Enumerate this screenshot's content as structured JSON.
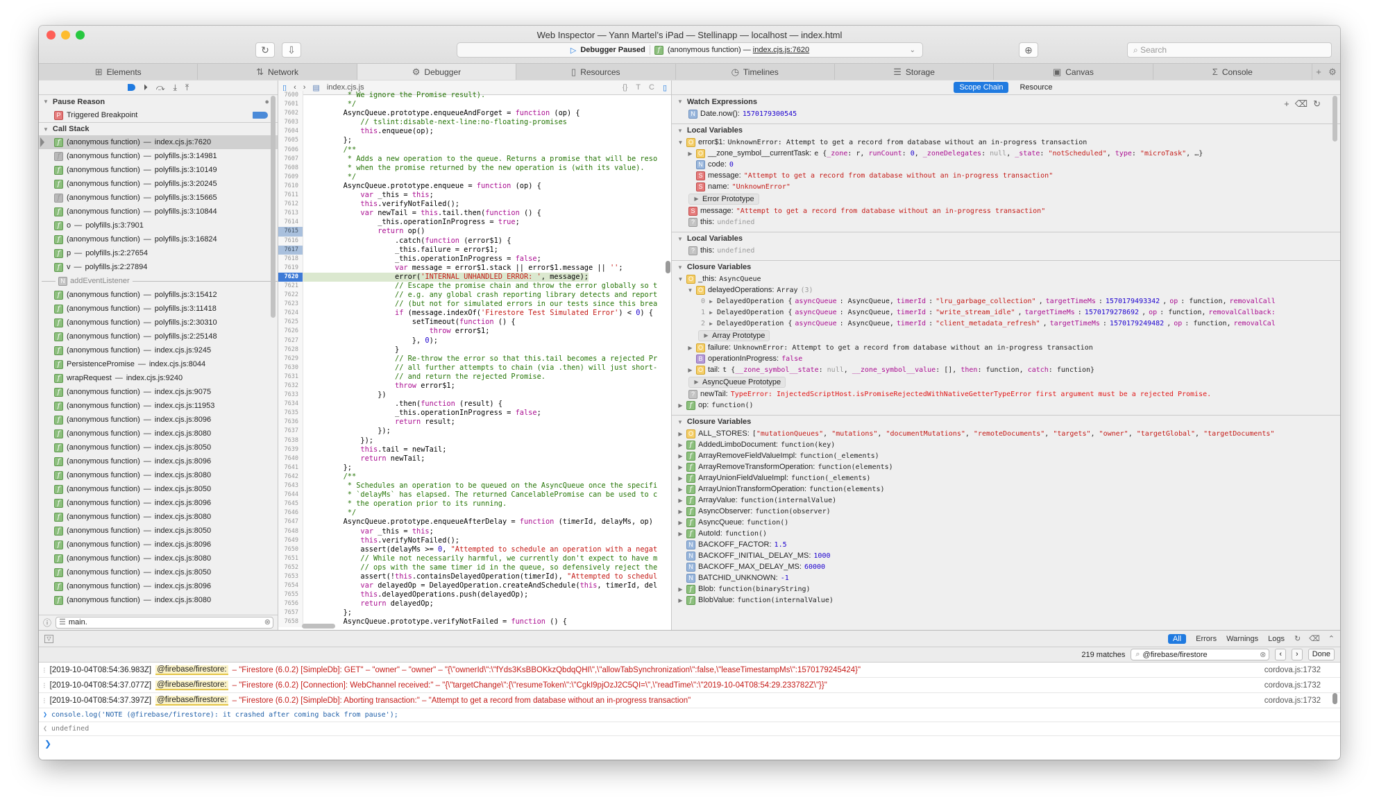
{
  "window": {
    "title": "Web Inspector — Yann Martel’s iPad — Stellinapp — localhost — index.html",
    "dashboard": {
      "status": "Debugger Paused",
      "frame_prefix": "(anonymous function) — ",
      "frame_link": "index.cjs.js:7620"
    },
    "search_placeholder": "Search"
  },
  "tabs": [
    {
      "label": "Elements",
      "icon": "elements-icon",
      "glyph": "⊞"
    },
    {
      "label": "Network",
      "icon": "network-icon",
      "glyph": "⇅"
    },
    {
      "label": "Debugger",
      "icon": "debugger-icon",
      "glyph": "⚙",
      "active": true
    },
    {
      "label": "Resources",
      "icon": "resources-icon",
      "glyph": "▯"
    },
    {
      "label": "Timelines",
      "icon": "timelines-icon",
      "glyph": "◷"
    },
    {
      "label": "Storage",
      "icon": "storage-icon",
      "glyph": "☰"
    },
    {
      "label": "Canvas",
      "icon": "canvas-icon",
      "glyph": "▣"
    },
    {
      "label": "Console",
      "icon": "console-icon",
      "glyph": "Σ"
    }
  ],
  "navigator": {
    "pause_reason_header": "Pause Reason",
    "pause_reason": "Triggered Breakpoint",
    "call_stack_header": "Call Stack",
    "frames_a": [
      {
        "name": "(anonymous function)",
        "loc": "index.cjs.js:7620",
        "kind": "f",
        "selected": true
      },
      {
        "name": "(anonymous function)",
        "loc": "polyfills.js:3:14981",
        "kind": "fgray"
      },
      {
        "name": "(anonymous function)",
        "loc": "polyfills.js:3:10149",
        "kind": "f"
      },
      {
        "name": "(anonymous function)",
        "loc": "polyfills.js:3:20245",
        "kind": "f"
      },
      {
        "name": "(anonymous function)",
        "loc": "polyfills.js:3:15665",
        "kind": "fgray"
      },
      {
        "name": "(anonymous function)",
        "loc": "polyfills.js:3:10844",
        "kind": "f"
      },
      {
        "name": "o",
        "loc": "polyfills.js:3:7901",
        "kind": "f"
      },
      {
        "name": "(anonymous function)",
        "loc": "polyfills.js:3:16824",
        "kind": "f"
      },
      {
        "name": "p",
        "loc": "polyfills.js:2:27654",
        "kind": "f"
      },
      {
        "name": "v",
        "loc": "polyfills.js:2:27894",
        "kind": "f"
      }
    ],
    "async_boundary": "addEventListener",
    "frames_b": [
      {
        "name": "(anonymous function)",
        "loc": "polyfills.js:3:15412"
      },
      {
        "name": "(anonymous function)",
        "loc": "polyfills.js:3:11418"
      },
      {
        "name": "(anonymous function)",
        "loc": "polyfills.js:2:30310"
      },
      {
        "name": "(anonymous function)",
        "loc": "polyfills.js:2:25148"
      },
      {
        "name": "(anonymous function)",
        "loc": "index.cjs.js:9245"
      },
      {
        "name": "PersistencePromise",
        "loc": "index.cjs.js:8044"
      },
      {
        "name": "wrapRequest",
        "loc": "index.cjs.js:9240"
      },
      {
        "name": "(anonymous function)",
        "loc": "index.cjs.js:9075"
      },
      {
        "name": "(anonymous function)",
        "loc": "index.cjs.js:11953"
      },
      {
        "name": "(anonymous function)",
        "loc": "index.cjs.js:8096"
      },
      {
        "name": "(anonymous function)",
        "loc": "index.cjs.js:8080"
      },
      {
        "name": "(anonymous function)",
        "loc": "index.cjs.js:8050"
      },
      {
        "name": "(anonymous function)",
        "loc": "index.cjs.js:8096"
      },
      {
        "name": "(anonymous function)",
        "loc": "index.cjs.js:8080"
      },
      {
        "name": "(anonymous function)",
        "loc": "index.cjs.js:8050"
      },
      {
        "name": "(anonymous function)",
        "loc": "index.cjs.js:8096"
      },
      {
        "name": "(anonymous function)",
        "loc": "index.cjs.js:8080"
      },
      {
        "name": "(anonymous function)",
        "loc": "index.cjs.js:8050"
      },
      {
        "name": "(anonymous function)",
        "loc": "index.cjs.js:8096"
      },
      {
        "name": "(anonymous function)",
        "loc": "index.cjs.js:8080"
      },
      {
        "name": "(anonymous function)",
        "loc": "index.cjs.js:8050"
      },
      {
        "name": "(anonymous function)",
        "loc": "index.cjs.js:8096"
      },
      {
        "name": "(anonymous function)",
        "loc": "index.cjs.js:8080"
      }
    ],
    "filter_value": "main."
  },
  "editor": {
    "filename": "index.cjs.js",
    "current_line": 7620,
    "breakpoint_lines": [
      7615,
      7617
    ],
    "lines": [
      {
        "n": 7600,
        "html": "         <span class=\"c\">* We ignore the Promise result).</span>"
      },
      {
        "n": 7601,
        "html": "         <span class=\"c\">*/</span>"
      },
      {
        "n": 7602,
        "html": "        AsyncQueue.prototype.enqueueAndForget = <span class=\"k\">function</span> (op) {"
      },
      {
        "n": 7603,
        "html": "            <span class=\"c\">// tslint:disable-next-line:no-floating-promises</span>"
      },
      {
        "n": 7604,
        "html": "            <span class=\"k\">this</span>.enqueue(op);"
      },
      {
        "n": 7605,
        "html": "        };"
      },
      {
        "n": 7606,
        "html": "        <span class=\"c\">/**</span>"
      },
      {
        "n": 7607,
        "html": "         <span class=\"c\">* Adds a new operation to the queue. Returns a promise that will be reso</span>"
      },
      {
        "n": 7608,
        "html": "         <span class=\"c\">* when the promise returned by the new operation is (with its value).</span>"
      },
      {
        "n": 7609,
        "html": "         <span class=\"c\">*/</span>"
      },
      {
        "n": 7610,
        "html": "        AsyncQueue.prototype.enqueue = <span class=\"k\">function</span> (op) {"
      },
      {
        "n": 7611,
        "html": "            <span class=\"k\">var</span> _this = <span class=\"k\">this</span>;"
      },
      {
        "n": 7612,
        "html": "            <span class=\"k\">this</span>.verifyNotFailed();"
      },
      {
        "n": 7613,
        "html": "            <span class=\"k\">var</span> newTail = <span class=\"k\">this</span>.tail.then(<span class=\"k\">function</span> () {"
      },
      {
        "n": 7614,
        "html": "                _this.operationInProgress = <span class=\"k\">true</span>;"
      },
      {
        "n": 7615,
        "html": "                <span class=\"k\">return</span> op()"
      },
      {
        "n": 7616,
        "html": "                    .catch(<span class=\"k\">function</span> (error$1) {"
      },
      {
        "n": 7617,
        "html": "                    _this.failure = error$1;"
      },
      {
        "n": 7618,
        "html": "                    _this.operationInProgress = <span class=\"k\">false</span>;"
      },
      {
        "n": 7619,
        "html": "                    <span class=\"k\">var</span> message = error$1.stack || error$1.message || <span class=\"s\">''</span>;"
      },
      {
        "n": 7620,
        "html": "                    error(<span class=\"s\">'INTERNAL UNHANDLED ERROR: '</span>, message);"
      },
      {
        "n": 7621,
        "html": "                    <span class=\"c\">// Escape the promise chain and throw the error globally so t</span>"
      },
      {
        "n": 7622,
        "html": "                    <span class=\"c\">// e.g. any global crash reporting library detects and report</span>"
      },
      {
        "n": 7623,
        "html": "                    <span class=\"c\">// (but not for simulated errors in our tests since this brea</span>"
      },
      {
        "n": 7624,
        "html": "                    <span class=\"k\">if</span> (message.indexOf(<span class=\"s\">'Firestore Test Simulated Error'</span>) &lt; <span class=\"n\">0</span>) {"
      },
      {
        "n": 7625,
        "html": "                        setTimeout(<span class=\"k\">function</span> () {"
      },
      {
        "n": 7626,
        "html": "                            <span class=\"k\">throw</span> error$1;"
      },
      {
        "n": 7627,
        "html": "                        }, <span class=\"n\">0</span>);"
      },
      {
        "n": 7628,
        "html": "                    }"
      },
      {
        "n": 7629,
        "html": "                    <span class=\"c\">// Re-throw the error so that this.tail becomes a rejected Pr</span>"
      },
      {
        "n": 7630,
        "html": "                    <span class=\"c\">// all further attempts to chain (via .then) will just short-</span>"
      },
      {
        "n": 7631,
        "html": "                    <span class=\"c\">// and return the rejected Promise.</span>"
      },
      {
        "n": 7632,
        "html": "                    <span class=\"k\">throw</span> error$1;"
      },
      {
        "n": 7633,
        "html": "                })"
      },
      {
        "n": 7634,
        "html": "                    .then(<span class=\"k\">function</span> (result) {"
      },
      {
        "n": 7635,
        "html": "                    _this.operationInProgress = <span class=\"k\">false</span>;"
      },
      {
        "n": 7636,
        "html": "                    <span class=\"k\">return</span> result;"
      },
      {
        "n": 7637,
        "html": "                });"
      },
      {
        "n": 7638,
        "html": "            });"
      },
      {
        "n": 7639,
        "html": "            <span class=\"k\">this</span>.tail = newTail;"
      },
      {
        "n": 7640,
        "html": "            <span class=\"k\">return</span> newTail;"
      },
      {
        "n": 7641,
        "html": "        };"
      },
      {
        "n": 7642,
        "html": "        <span class=\"c\">/**</span>"
      },
      {
        "n": 7643,
        "html": "         <span class=\"c\">* Schedules an operation to be queued on the AsyncQueue once the specifi</span>"
      },
      {
        "n": 7644,
        "html": "         <span class=\"c\">* `delayMs` has elapsed. The returned CancelablePromise can be used to c</span>"
      },
      {
        "n": 7645,
        "html": "         <span class=\"c\">* the operation prior to its running.</span>"
      },
      {
        "n": 7646,
        "html": "         <span class=\"c\">*/</span>"
      },
      {
        "n": 7647,
        "html": "        AsyncQueue.prototype.enqueueAfterDelay = <span class=\"k\">function</span> (timerId, delayMs, op)"
      },
      {
        "n": 7648,
        "html": "            <span class=\"k\">var</span> _this = <span class=\"k\">this</span>;"
      },
      {
        "n": 7649,
        "html": "            <span class=\"k\">this</span>.verifyNotFailed();"
      },
      {
        "n": 7650,
        "html": "            assert(delayMs &gt;= <span class=\"n\">0</span>, <span class=\"s\">\"Attempted to schedule an operation with a negat</span>"
      },
      {
        "n": 7651,
        "html": "            <span class=\"c\">// While not necessarily harmful, we currently don't expect to have m</span>"
      },
      {
        "n": 7652,
        "html": "            <span class=\"c\">// ops with the same timer id in the queue, so defensively reject the</span>"
      },
      {
        "n": 7653,
        "html": "            assert(!<span class=\"k\">this</span>.containsDelayedOperation(timerId), <span class=\"s\">\"Attempted to schedul</span>"
      },
      {
        "n": 7654,
        "html": "            <span class=\"k\">var</span> delayedOp = DelayedOperation.createAndSchedule(<span class=\"k\">this</span>, timerId, del"
      },
      {
        "n": 7655,
        "html": "            <span class=\"k\">this</span>.delayedOperations.push(delayedOp);"
      },
      {
        "n": 7656,
        "html": "            <span class=\"k\">return</span> delayedOp;"
      },
      {
        "n": 7657,
        "html": "        };"
      },
      {
        "n": 7658,
        "html": "        AsyncQueue.prototype.verifyNotFailed = <span class=\"k\">function</span> () {"
      }
    ]
  },
  "sidebar": {
    "segments": [
      "Scope Chain",
      "Resource"
    ],
    "watch": {
      "header": "Watch Expressions",
      "expr": "Date.now():",
      "value": "1570179300545"
    },
    "local1": {
      "header": "Local Variables",
      "error_name": "error$1:",
      "error_value": "UnknownError: Attempt to get a record from database without an in-progress transaction",
      "zone_name": "__zone_symbol__currentTask:",
      "zone_value": "e {<span class=\"ptag\">_zone</span>: r, <span class=\"ptag\">runCount</span>: <span class=\"blue\">0</span>, <span class=\"ptag\">_zoneDelegates</span>: <span class=\"gray\">null</span>, <span class=\"ptag\">_state</span>: <span class=\"red\">\"notScheduled\"</span>, <span class=\"ptag\">type</span>: <span class=\"red\">\"microTask\"</span>, …}",
      "code_name": "code:",
      "code_value": "0",
      "msg_name": "message:",
      "msg_value": "\"Attempt to get a record from database without an in-progress transaction\"",
      "name_name": "name:",
      "name_value": "\"UnknownError\"",
      "proto": "Error Prototype",
      "message_name": "message:",
      "message_value": "\"Attempt to get a record from database without an in-progress transaction\"",
      "this_name": "this:",
      "this_value": "undefined"
    },
    "local2": {
      "header": "Local Variables",
      "this_name": "this:",
      "this_value": "undefined"
    },
    "closure1": {
      "header": "Closure Variables",
      "this_name": "_this:",
      "this_value": "AsyncQueue",
      "delayed_name": "delayedOperations:",
      "delayed_value": "Array",
      "delayed_count": "(3)",
      "items": [
        {
          "idx": "0",
          "timerId": "\"lru_garbage_collection\"",
          "target": "1570179493342",
          "tail": "removalCall"
        },
        {
          "idx": "1",
          "timerId": "\"write_stream_idle\"",
          "target": "1570179278692",
          "tail": "removalCallback:"
        },
        {
          "idx": "2",
          "timerId": "\"client_metadata_refresh\"",
          "target": "1570179249482",
          "tail": "removalCal"
        }
      ],
      "array_proto": "Array Prototype",
      "failure_name": "failure:",
      "failure_value": "UnknownError: Attempt to get a record from database without an in-progress transaction",
      "oip_name": "operationInProgress:",
      "oip_value": "false",
      "tail_name": "tail:",
      "tail_value": "t {<span class=\"ptag\">__zone_symbol__state</span>: <span class=\"gray\">null</span>, <span class=\"ptag\">__zone_symbol__value</span>: [], <span class=\"ptag\">then</span>: function, <span class=\"ptag\">catch</span>: function}",
      "aq_proto": "AsyncQueue Prototype",
      "newtail_name": "newTail:",
      "newtail_value": "TypeError: InjectedScriptHost.isPromiseRejectedWithNativeGetterTypeError first argument must be a rejected Promise.",
      "op_name": "op:",
      "op_value": "function()"
    },
    "closure2": {
      "header": "Closure Variables",
      "all_stores_name": "ALL_STORES:",
      "all_stores_value": "[<span class=\"red\">\"mutationQueues\"</span>, <span class=\"red\">\"mutations\"</span>, <span class=\"red\">\"documentMutations\"</span>, <span class=\"red\">\"remoteDocuments\"</span>, <span class=\"red\">\"targets\"</span>, <span class=\"red\">\"owner\"</span>, <span class=\"red\">\"targetGlobal\"</span>, <span class=\"red\">\"targetDocuments\"</span>",
      "funcs": [
        {
          "name": "AddedLimboDocument:",
          "value": "function(key)"
        },
        {
          "name": "ArrayRemoveFieldValueImpl:",
          "value": "function(_elements)"
        },
        {
          "name": "ArrayRemoveTransformOperation:",
          "value": "function(elements)"
        },
        {
          "name": "ArrayUnionFieldValueImpl:",
          "value": "function(_elements)"
        },
        {
          "name": "ArrayUnionTransformOperation:",
          "value": "function(elements)"
        },
        {
          "name": "ArrayValue:",
          "value": "function(internalValue)"
        },
        {
          "name": "AsyncObserver:",
          "value": "function(observer)"
        },
        {
          "name": "AsyncQueue:",
          "value": "function()"
        },
        {
          "name": "AutoId:",
          "value": "function()"
        }
      ],
      "nums": [
        {
          "name": "BACKOFF_FACTOR:",
          "value": "1.5"
        },
        {
          "name": "BACKOFF_INITIAL_DELAY_MS:",
          "value": "1000"
        },
        {
          "name": "BACKOFF_MAX_DELAY_MS:",
          "value": "60000"
        },
        {
          "name": "BATCHID_UNKNOWN:",
          "value": "-1"
        }
      ],
      "funcs2": [
        {
          "name": "Blob:",
          "value": "function(binaryString)"
        },
        {
          "name": "BlobValue:",
          "value": "function(internalValue)"
        }
      ]
    }
  },
  "console": {
    "filters": [
      "All",
      "Errors",
      "Warnings",
      "Logs"
    ],
    "matches": "219 matches",
    "find_value": "@firebase/firestore",
    "done_label": "Done",
    "messages": [
      {
        "ts": "[2019-10-04T08:54:36.983Z]",
        "tag": "@firebase/firestore:",
        "body": " – \"Firestore (6.0.2) [SimpleDb]: GET\" – \"owner\" – \"owner\" – \"{\\\"ownerId\\\":\\\"fYds3KsBBOKkzQbdqQHI\\\",\\\"allowTabSynchronization\\\":false,\\\"leaseTimestampMs\\\":1570179245424}\"",
        "loc": "cordova.js:1732"
      },
      {
        "ts": "[2019-10-04T08:54:37.077Z]",
        "tag": "@firebase/firestore:",
        "body": " – \"Firestore (6.0.2) [Connection]: WebChannel received:\" – \"{\\\"targetChange\\\":{\\\"resumeToken\\\":\\\"CgkI9pjOzJ2C5QI=\\\",\\\"readTime\\\":\\\"2019-10-04T08:54:29.233782Z\\\"}}\"",
        "loc": "cordova.js:1732"
      },
      {
        "ts": "[2019-10-04T08:54:37.397Z]",
        "tag": "@firebase/firestore:",
        "body": " – \"Firestore (6.0.2) [SimpleDb]: Aborting transaction:\" – \"Attempt to get a record from database without an in-progress transaction\"",
        "loc": "cordova.js:1732"
      }
    ],
    "input": "console.log('NOTE (@firebase/firestore): it crashed after coming back from pause');",
    "output": "undefined"
  }
}
